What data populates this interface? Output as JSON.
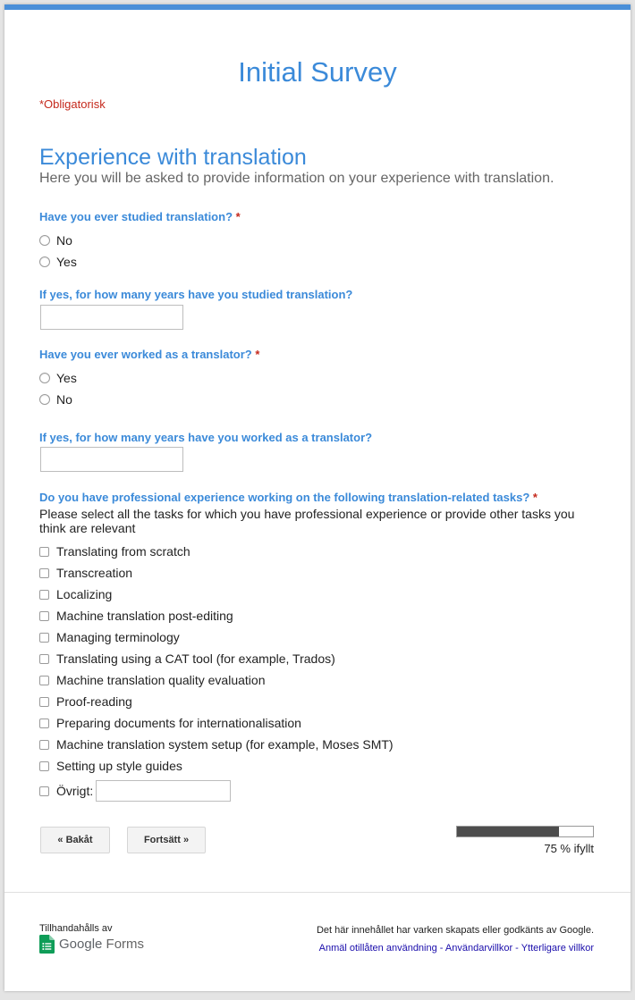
{
  "form": {
    "title": "Initial Survey",
    "required_note": "*Obligatorisk"
  },
  "section": {
    "title": "Experience with translation",
    "description": "Here you will be asked to provide information on your experience with translation."
  },
  "questions": {
    "q1": {
      "title": "Have you ever studied translation?",
      "required_mark": "*",
      "options": [
        "No",
        "Yes"
      ]
    },
    "q2": {
      "title": "If yes, for how many years have you studied translation?",
      "value": ""
    },
    "q3": {
      "title": "Have you ever worked as a translator?",
      "required_mark": "*",
      "options": [
        "Yes",
        "No"
      ]
    },
    "q4": {
      "title": "If yes, for how many years have you worked as a translator?",
      "value": ""
    },
    "q5": {
      "title": "Do you have professional experience working on the following translation-related tasks?",
      "required_mark": "*",
      "help": "Please select all the tasks for which you have professional experience or provide other tasks you think are relevant",
      "options": [
        "Translating from scratch",
        "Transcreation",
        "Localizing",
        "Machine translation post-editing",
        "Managing terminology",
        "Translating using a CAT tool (for example, Trados)",
        "Machine translation quality evaluation",
        "Proof-reading",
        "Preparing documents for internationalisation",
        "Machine translation system setup (for example, Moses SMT)",
        "Setting up style guides"
      ],
      "other_label": "Övrigt:",
      "other_value": ""
    }
  },
  "navigation": {
    "back_label": "« Bakåt",
    "continue_label": "Fortsätt »"
  },
  "progress": {
    "percent": 75,
    "label": "75 % ifyllt"
  },
  "footer": {
    "provided_by": "Tillhandahålls av",
    "brand_google": "Google",
    "brand_forms": "Forms",
    "disclaimer": "Det här innehållet har varken skapats eller godkänts av Google.",
    "links": [
      "Anmäl otillåten användning",
      "Användarvillkor",
      "Ytterligare villkor"
    ],
    "link_separator": " - "
  },
  "colors": {
    "accent": "#3b8ad9",
    "top_bar": "#4a8fd8",
    "required": "#c5291c",
    "link": "#1a0dab",
    "forms_green": "#0f9d58"
  },
  "icons": [
    "google-forms-icon"
  ]
}
